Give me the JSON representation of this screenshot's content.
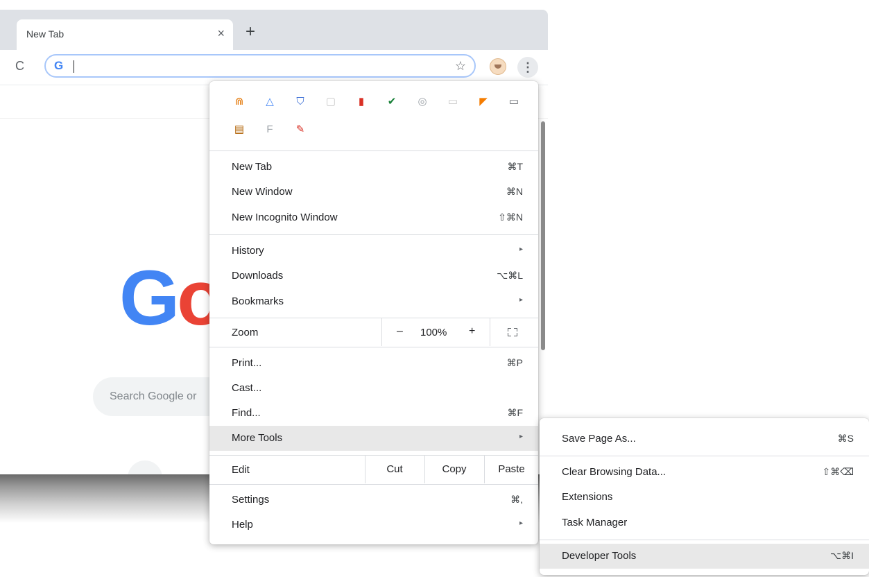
{
  "browser": {
    "tab": {
      "title": "New Tab",
      "close": "×"
    },
    "new_tab_glyph": "+",
    "reload_glyph": "C",
    "omnibox": {
      "value": "",
      "g_icon": "G",
      "star_glyph": "☆"
    },
    "menu_glyph": "⋮"
  },
  "page": {
    "logo_letters": [
      "G",
      "o"
    ],
    "search_placeholder": "Search Google or"
  },
  "menu": {
    "extensions": [
      {
        "icon": "orange-arch-extension-icon",
        "glyph": "⋒",
        "color": "#e37400"
      },
      {
        "icon": "triangle-extension-icon",
        "glyph": "△",
        "color": "#4285f4"
      },
      {
        "icon": "shield-extension-icon",
        "glyph": "⛉",
        "color": "#3c6fd6"
      },
      {
        "icon": "grey-square-extension-icon",
        "glyph": "▢",
        "color": "#c8c8c8"
      },
      {
        "icon": "red-book-extension-icon",
        "glyph": "▮",
        "color": "#d93025"
      },
      {
        "icon": "green-check-extension-icon",
        "glyph": "✔",
        "color": "#188038"
      },
      {
        "icon": "grey-badge-extension-icon",
        "glyph": "◎",
        "color": "#9aa0a6"
      },
      {
        "icon": "grey-tag-extension-icon",
        "glyph": "▭",
        "color": "#c8c8c8"
      },
      {
        "icon": "chart-extension-icon",
        "glyph": "◤",
        "color": "#f57c00"
      },
      {
        "icon": "laptop-extension-icon",
        "glyph": "▭",
        "color": "#5f6368"
      },
      {
        "icon": "notebook-extension-icon",
        "glyph": "▤",
        "color": "#b06000"
      },
      {
        "icon": "f-extension-icon",
        "glyph": "F",
        "color": "#9aa0a6"
      },
      {
        "icon": "brush-extension-icon",
        "glyph": "✎",
        "color": "#d93025"
      }
    ],
    "new_tab": {
      "label": "New Tab",
      "shortcut": "⌘T"
    },
    "new_window": {
      "label": "New Window",
      "shortcut": "⌘N"
    },
    "new_incognito": {
      "label": "New Incognito Window",
      "shortcut": "⇧⌘N"
    },
    "history": {
      "label": "History",
      "arrow": "▸"
    },
    "downloads": {
      "label": "Downloads",
      "shortcut": "⌥⌘L"
    },
    "bookmarks": {
      "label": "Bookmarks",
      "arrow": "▸"
    },
    "zoom": {
      "label": "Zoom",
      "minus": "–",
      "value": "100%",
      "plus": "+"
    },
    "print": {
      "label": "Print...",
      "shortcut": "⌘P"
    },
    "cast": {
      "label": "Cast..."
    },
    "find": {
      "label": "Find...",
      "shortcut": "⌘F"
    },
    "more_tools": {
      "label": "More Tools",
      "arrow": "▸"
    },
    "edit": {
      "label": "Edit",
      "cut": "Cut",
      "copy": "Copy",
      "paste": "Paste"
    },
    "settings": {
      "label": "Settings",
      "shortcut": "⌘,"
    },
    "help": {
      "label": "Help",
      "arrow": "▸"
    }
  },
  "submenu": {
    "save_page": {
      "label": "Save Page As...",
      "shortcut": "⌘S"
    },
    "clear_data": {
      "label": "Clear Browsing Data...",
      "shortcut": "⇧⌘⌫"
    },
    "extensions": {
      "label": "Extensions"
    },
    "task_manager": {
      "label": "Task Manager"
    },
    "developer_tools": {
      "label": "Developer Tools",
      "shortcut": "⌥⌘I"
    }
  }
}
